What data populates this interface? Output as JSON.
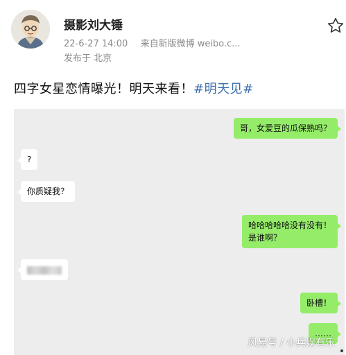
{
  "header": {
    "author": "摄影刘大锤",
    "date": "22-6-27 14:00",
    "source": "来自新版微博 weibo.c...",
    "location": "发布于 北京",
    "star_icon": "star-outline-icon"
  },
  "post": {
    "text": "四字女星恋情曝光！明天来看！",
    "hashtag": "#明天见#"
  },
  "chat": {
    "messages": [
      {
        "side": "right",
        "text": "哥，女爱豆的瓜保熟吗？"
      },
      {
        "side": "left",
        "text": "?"
      },
      {
        "side": "left",
        "text": "你质疑我？"
      },
      {
        "side": "right",
        "text": "哈哈哈哈哈没有没有！",
        "text2": "是谁啊？"
      },
      {
        "side": "left",
        "text": "",
        "blurred": true
      },
      {
        "side": "right",
        "text": "卧槽！"
      },
      {
        "side": "right",
        "text": "……"
      }
    ],
    "background": "#ededed",
    "bubble_color": "#95ec69"
  },
  "watermark": "风易号 / 小兵娱有乐"
}
